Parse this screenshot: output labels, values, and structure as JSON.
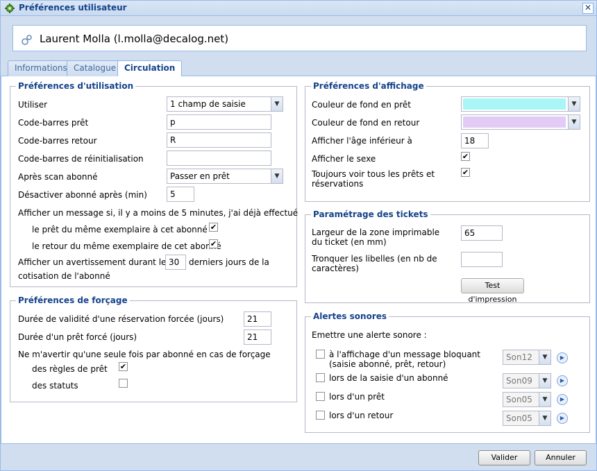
{
  "window": {
    "title": "Préférences utilisateur",
    "close_symbol": "✕"
  },
  "user": {
    "name": "Laurent Molla (l.molla@decalog.net)"
  },
  "tabs": [
    {
      "label": "Informations"
    },
    {
      "label": "Catalogue"
    },
    {
      "label": "Circulation",
      "active": true
    }
  ],
  "usage": {
    "legend": "Préférences d'utilisation",
    "utiliser_label": "Utiliser",
    "utiliser_value": "1 champ de saisie",
    "pret_label": "Code-barres prêt",
    "pret_value": "p",
    "retour_label": "Code-barres retour",
    "retour_value": "R",
    "reinit_label": "Code-barres de réinitialisation",
    "reinit_value": "",
    "apres_label": "Après scan abonné",
    "apres_value": "Passer en prêt",
    "desactiver_label": "Désactiver abonné après (min)",
    "desactiver_value": "5",
    "message_label": "Afficher un message si, il y a moins de 5 minutes, j'ai déjà effectué",
    "pret_meme_label": "le prêt du même exemplaire à cet abonné",
    "pret_meme_checked": true,
    "retour_meme_label": "le retour du même exemplaire de cet abonné",
    "retour_meme_checked": true,
    "avert_label_a": "Afficher un avertissement durant les",
    "avert_value": "30",
    "avert_label_b": "derniers jours de la",
    "avert_label_c": "cotisation de l'abonné"
  },
  "forcage": {
    "legend": "Préférences de forçage",
    "validite_label": "Durée de validité d'une réservation forcée (jours)",
    "validite_value": "21",
    "pret_force_label": "Durée d'un prêt forcé (jours)",
    "pret_force_value": "21",
    "avertir_label": "Ne m'avertir qu'une seule fois par abonné en cas de forçage",
    "regles_label": "des règles de prêt",
    "regles_checked": true,
    "statuts_label": "des statuts",
    "statuts_checked": false
  },
  "affichage": {
    "legend": "Préférences d'affichage",
    "fond_pret_label": "Couleur de fond en prêt",
    "fond_pret_color": "#aaf5f5",
    "fond_retour_label": "Couleur de fond en retour",
    "fond_retour_color": "#e2ccf5",
    "age_label": "Afficher l'âge inférieur à",
    "age_value": "18",
    "sexe_label": "Afficher le sexe",
    "sexe_checked": true,
    "tous_label": "Toujours voir tous les prêts et réservations",
    "tous_checked": true
  },
  "tickets": {
    "legend": "Paramétrage des tickets",
    "largeur_label": "Largeur de la zone imprimable du ticket (en mm)",
    "largeur_value": "65",
    "tronquer_label": "Tronquer les libelles (en nb de caractères)",
    "tronquer_value": "",
    "test_button": "Test d'impression"
  },
  "alertes": {
    "legend": "Alertes sonores",
    "emettre_label": "Emettre une alerte sonore :",
    "items": [
      {
        "label": "à l'affichage d'un message bloquant (saisie abonné, prêt, retour)",
        "sound": "Son12",
        "checked": false
      },
      {
        "label": "lors de la saisie d'un abonné",
        "sound": "Son09",
        "checked": false
      },
      {
        "label": "lors d'un prêt",
        "sound": "Son05",
        "checked": false
      },
      {
        "label": "lors d'un retour",
        "sound": "Son05",
        "checked": false
      }
    ]
  },
  "footer": {
    "valider": "Valider",
    "annuler": "Annuler"
  },
  "glyphs": {
    "check": "✔",
    "arrow": "▼",
    "play": "▶"
  }
}
